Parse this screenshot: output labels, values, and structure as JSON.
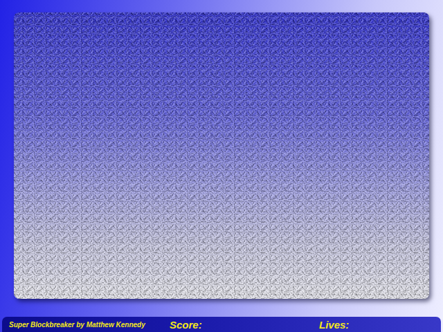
{
  "window": {
    "title": "Super Blockbreaker"
  },
  "status_bar": {
    "credit": "Super Blockbreaker by Matthew Kennedy",
    "score_label": "Score:",
    "lives_label": "Lives:"
  }
}
